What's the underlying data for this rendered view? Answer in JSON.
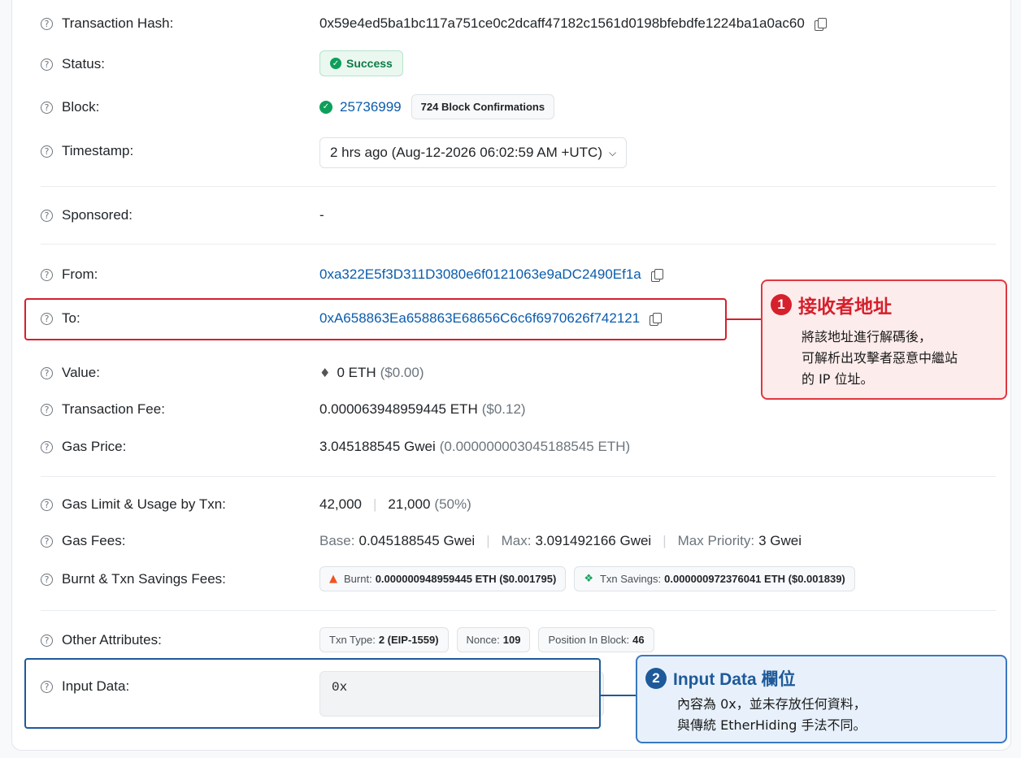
{
  "rows": {
    "hash": {
      "label": "Transaction Hash:",
      "value": "0x59e4ed5ba1bc117a751ce0c2dcaff47182c1561d0198bfebdfe1224ba1a0ac60"
    },
    "status": {
      "label": "Status:",
      "value": "Success"
    },
    "block": {
      "label": "Block:",
      "value": "25736999",
      "confirmations": "724 Block Confirmations"
    },
    "timestamp": {
      "label": "Timestamp:",
      "value": "2 hrs ago (Aug-12-2026 06:02:59 AM +UTC)"
    },
    "sponsored": {
      "label": "Sponsored:",
      "value": "-"
    },
    "from": {
      "label": "From:",
      "value": "0xa322E5f3D311D3080e6f0121063e9aDC2490Ef1a"
    },
    "to": {
      "label": "To:",
      "value": "0xA658863Ea658863E68656C6c6f6970626f742121"
    },
    "value": {
      "label": "Value:",
      "amount": "0 ETH",
      "usd": "($0.00)"
    },
    "fee": {
      "label": "Transaction Fee:",
      "amount": "0.000063948959445 ETH",
      "usd": "($0.12)"
    },
    "gas_price": {
      "label": "Gas Price:",
      "amount": "3.045188545 Gwei",
      "eth": "(0.000000003045188545 ETH)"
    },
    "gas_limit": {
      "label": "Gas Limit & Usage by Txn:",
      "limit": "42,000",
      "used": "21,000",
      "pct": "(50%)"
    },
    "gas_fees": {
      "label": "Gas Fees:",
      "base_label": "Base:",
      "base": "0.045188545 Gwei",
      "max_label": "Max:",
      "max": "3.091492166 Gwei",
      "prio_label": "Max Priority:",
      "prio": "3 Gwei"
    },
    "burnt": {
      "label": "Burnt & Txn Savings Fees:",
      "burnt_label": "Burnt:",
      "burnt_value": "0.000000948959445 ETH ($0.001795)",
      "savings_label": "Txn Savings:",
      "savings_value": "0.000000972376041 ETH ($0.001839)"
    },
    "other": {
      "label": "Other Attributes:",
      "txn_type_label": "Txn Type:",
      "txn_type": "2 (EIP-1559)",
      "nonce_label": "Nonce:",
      "nonce": "109",
      "position_label": "Position In Block:",
      "position": "46"
    },
    "input": {
      "label": "Input Data:",
      "value": "0x"
    }
  },
  "callouts": {
    "one": {
      "num": "1",
      "title": "接收者地址",
      "line1": "將該地址進行解碼後，",
      "line2": "可解析出攻擊者惡意中繼站",
      "line3": "的 IP 位址。"
    },
    "two": {
      "num": "2",
      "title": "Input Data 欄位",
      "line1": "內容為 0x，並未存放任何資料，",
      "line2": "與傳統 EtherHiding 手法不同。"
    }
  },
  "colors": {
    "accent_red": "#d6202c",
    "accent_blue": "#1e5a99",
    "link": "#0b5cad",
    "success": "#0e9f5a"
  }
}
